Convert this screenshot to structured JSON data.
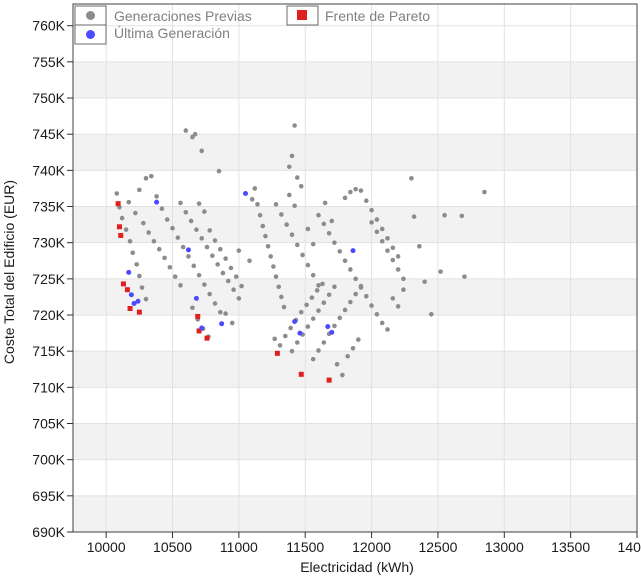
{
  "chart_data": {
    "type": "scatter",
    "xlabel": "Electricidad (kWh)",
    "ylabel": "Coste Total del Edificio (EUR)",
    "xlim": [
      9750,
      14000
    ],
    "ylim": [
      690000,
      763000
    ],
    "x_ticks": [
      10000,
      10500,
      11000,
      11500,
      12000,
      12500,
      13000,
      13500,
      14000
    ],
    "x_tick_labels": [
      "10000",
      "10500",
      "11000",
      "11500",
      "12000",
      "12500",
      "13000",
      "13500",
      "14000"
    ],
    "y_ticks": [
      690000,
      695000,
      700000,
      705000,
      710000,
      715000,
      720000,
      725000,
      730000,
      735000,
      740000,
      745000,
      750000,
      755000,
      760000
    ],
    "y_tick_labels": [
      "690K",
      "695K",
      "700K",
      "705K",
      "710K",
      "715K",
      "720K",
      "725K",
      "730K",
      "735K",
      "740K",
      "745K",
      "750K",
      "755K",
      "760K"
    ],
    "grid": true,
    "legend_position": "top-left",
    "series": [
      {
        "name": "Generaciones Previas",
        "color": "#8c8c8c",
        "points": [
          [
            10080,
            736800
          ],
          [
            10100,
            734900
          ],
          [
            10120,
            733400
          ],
          [
            10150,
            731800
          ],
          [
            10180,
            730200
          ],
          [
            10200,
            728600
          ],
          [
            10230,
            727000
          ],
          [
            10250,
            725400
          ],
          [
            10270,
            723800
          ],
          [
            10300,
            722200
          ],
          [
            10170,
            735600
          ],
          [
            10220,
            734100
          ],
          [
            10280,
            732700
          ],
          [
            10320,
            731400
          ],
          [
            10360,
            730200
          ],
          [
            10400,
            729100
          ],
          [
            10440,
            727900
          ],
          [
            10480,
            726600
          ],
          [
            10520,
            725300
          ],
          [
            10560,
            724100
          ],
          [
            10250,
            737300
          ],
          [
            10300,
            738900
          ],
          [
            10340,
            739200
          ],
          [
            10380,
            736400
          ],
          [
            10420,
            734700
          ],
          [
            10460,
            733200
          ],
          [
            10500,
            732000
          ],
          [
            10540,
            730700
          ],
          [
            10580,
            729400
          ],
          [
            10620,
            728100
          ],
          [
            10660,
            726800
          ],
          [
            10700,
            725500
          ],
          [
            10740,
            724200
          ],
          [
            10780,
            722900
          ],
          [
            10820,
            721600
          ],
          [
            10860,
            720400
          ],
          [
            10600,
            745500
          ],
          [
            10650,
            744600
          ],
          [
            10670,
            745000
          ],
          [
            10720,
            742700
          ],
          [
            10850,
            739900
          ],
          [
            10560,
            735500
          ],
          [
            10600,
            734200
          ],
          [
            10640,
            733000
          ],
          [
            10680,
            731800
          ],
          [
            10720,
            730600
          ],
          [
            10760,
            729400
          ],
          [
            10800,
            728200
          ],
          [
            10840,
            727000
          ],
          [
            10880,
            725800
          ],
          [
            10920,
            724700
          ],
          [
            10960,
            723500
          ],
          [
            11000,
            722300
          ],
          [
            10700,
            735400
          ],
          [
            10740,
            734300
          ],
          [
            10780,
            731700
          ],
          [
            10820,
            730300
          ],
          [
            10860,
            729100
          ],
          [
            10900,
            727800
          ],
          [
            10940,
            726500
          ],
          [
            10980,
            725300
          ],
          [
            11020,
            724000
          ],
          [
            10650,
            721000
          ],
          [
            10690,
            719400
          ],
          [
            10730,
            718100
          ],
          [
            10770,
            717000
          ],
          [
            10900,
            720200
          ],
          [
            10950,
            718900
          ],
          [
            11000,
            728900
          ],
          [
            11080,
            727500
          ],
          [
            11100,
            736000
          ],
          [
            11120,
            737500
          ],
          [
            11140,
            735300
          ],
          [
            11160,
            733800
          ],
          [
            11180,
            732300
          ],
          [
            11200,
            730900
          ],
          [
            11220,
            729500
          ],
          [
            11240,
            728100
          ],
          [
            11260,
            726700
          ],
          [
            11280,
            725300
          ],
          [
            11300,
            723900
          ],
          [
            11320,
            722500
          ],
          [
            11340,
            721100
          ],
          [
            11280,
            735300
          ],
          [
            11320,
            733900
          ],
          [
            11360,
            732500
          ],
          [
            11400,
            731100
          ],
          [
            11440,
            729700
          ],
          [
            11480,
            728300
          ],
          [
            11520,
            726900
          ],
          [
            11560,
            725500
          ],
          [
            11600,
            724100
          ],
          [
            11420,
            746200
          ],
          [
            11400,
            742000
          ],
          [
            11380,
            740500
          ],
          [
            11440,
            739000
          ],
          [
            11470,
            737800
          ],
          [
            11380,
            736600
          ],
          [
            11420,
            735100
          ],
          [
            11270,
            716700
          ],
          [
            11310,
            715800
          ],
          [
            11350,
            717100
          ],
          [
            11390,
            718200
          ],
          [
            11430,
            719300
          ],
          [
            11470,
            720400
          ],
          [
            11510,
            721400
          ],
          [
            11550,
            722400
          ],
          [
            11590,
            723400
          ],
          [
            11630,
            724300
          ],
          [
            11400,
            715000
          ],
          [
            11440,
            716200
          ],
          [
            11480,
            717300
          ],
          [
            11520,
            718400
          ],
          [
            11560,
            719500
          ],
          [
            11600,
            720600
          ],
          [
            11640,
            721700
          ],
          [
            11680,
            722800
          ],
          [
            11720,
            723900
          ],
          [
            11560,
            713900
          ],
          [
            11600,
            715100
          ],
          [
            11640,
            716200
          ],
          [
            11680,
            717400
          ],
          [
            11720,
            718500
          ],
          [
            11760,
            719600
          ],
          [
            11800,
            720700
          ],
          [
            11840,
            721800
          ],
          [
            11880,
            722900
          ],
          [
            11920,
            724000
          ],
          [
            11740,
            713200
          ],
          [
            11780,
            711700
          ],
          [
            11820,
            714300
          ],
          [
            11860,
            715400
          ],
          [
            11900,
            716600
          ],
          [
            11600,
            733800
          ],
          [
            11640,
            732600
          ],
          [
            11680,
            731300
          ],
          [
            11720,
            730000
          ],
          [
            11760,
            728800
          ],
          [
            11800,
            727500
          ],
          [
            11840,
            726300
          ],
          [
            11880,
            725000
          ],
          [
            11920,
            723800
          ],
          [
            11960,
            722600
          ],
          [
            11800,
            736200
          ],
          [
            11840,
            737000
          ],
          [
            11880,
            737400
          ],
          [
            11920,
            737200
          ],
          [
            11960,
            735800
          ],
          [
            12000,
            734500
          ],
          [
            12040,
            733200
          ],
          [
            12080,
            731900
          ],
          [
            12120,
            730600
          ],
          [
            12160,
            729300
          ],
          [
            12200,
            728100
          ],
          [
            12000,
            732800
          ],
          [
            12040,
            731500
          ],
          [
            12080,
            730200
          ],
          [
            12120,
            728900
          ],
          [
            12160,
            727600
          ],
          [
            12200,
            726300
          ],
          [
            12240,
            725000
          ],
          [
            12000,
            721300
          ],
          [
            12040,
            720100
          ],
          [
            12080,
            718900
          ],
          [
            12120,
            718000
          ],
          [
            12160,
            722300
          ],
          [
            12200,
            721200
          ],
          [
            12240,
            723500
          ],
          [
            12300,
            738900
          ],
          [
            12320,
            733600
          ],
          [
            12360,
            729500
          ],
          [
            12400,
            724600
          ],
          [
            12450,
            720100
          ],
          [
            12520,
            726000
          ],
          [
            12550,
            733800
          ],
          [
            12680,
            733700
          ],
          [
            12700,
            725300
          ],
          [
            12850,
            737000
          ],
          [
            11650,
            735500
          ],
          [
            11560,
            729800
          ],
          [
            11520,
            731900
          ],
          [
            11700,
            733000
          ]
        ]
      },
      {
        "name": "Frente de Pareto",
        "color": "#e01f1f",
        "points": [
          [
            10090,
            735400
          ],
          [
            10100,
            732200
          ],
          [
            10110,
            731000
          ],
          [
            10130,
            724300
          ],
          [
            10160,
            723500
          ],
          [
            10180,
            720900
          ],
          [
            10250,
            720400
          ],
          [
            10690,
            719800
          ],
          [
            10700,
            717800
          ],
          [
            10760,
            716800
          ],
          [
            11290,
            714700
          ],
          [
            11470,
            711800
          ],
          [
            11680,
            711000
          ]
        ]
      },
      {
        "name": "Última Generación",
        "color": "#4a4aff",
        "points": [
          [
            10170,
            725900
          ],
          [
            10190,
            722800
          ],
          [
            10210,
            721600
          ],
          [
            10240,
            721900
          ],
          [
            10380,
            735600
          ],
          [
            10620,
            729000
          ],
          [
            10680,
            722300
          ],
          [
            10720,
            718200
          ],
          [
            10870,
            718800
          ],
          [
            11050,
            736800
          ],
          [
            11420,
            719100
          ],
          [
            11460,
            717500
          ],
          [
            11670,
            718400
          ],
          [
            11700,
            717600
          ],
          [
            11860,
            728900
          ]
        ]
      }
    ]
  }
}
